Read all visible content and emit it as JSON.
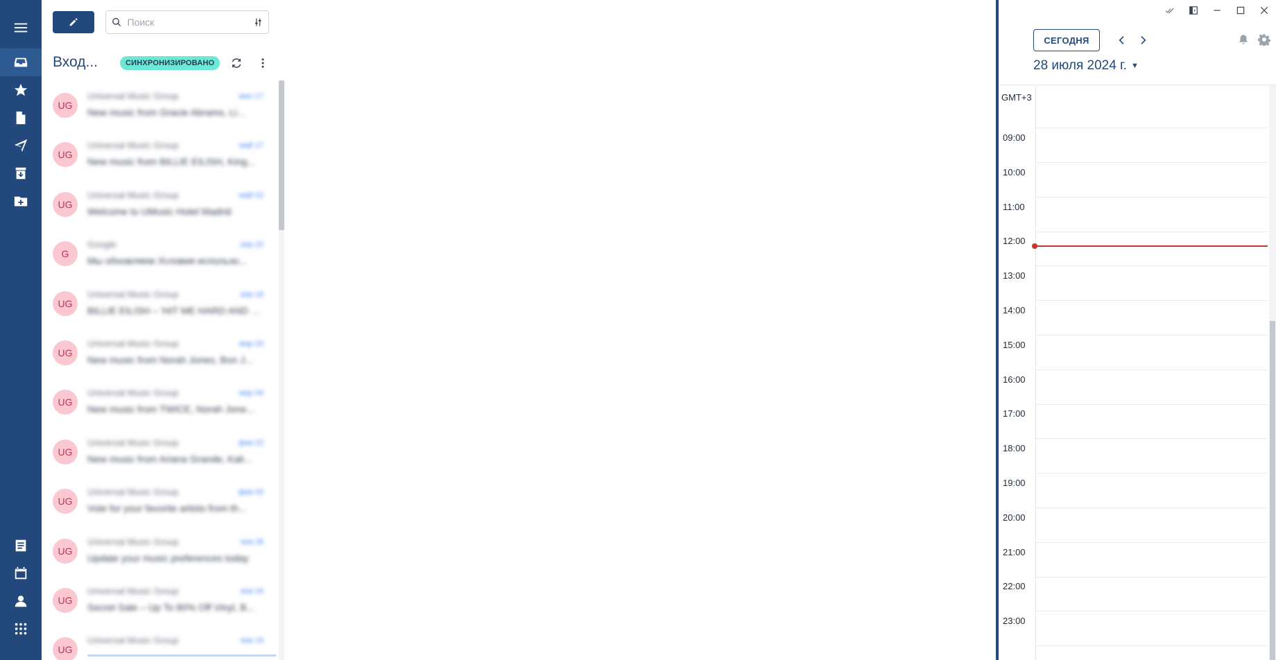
{
  "rail": {
    "items": [
      {
        "name": "menu",
        "icon": "hamburger-menu-icon"
      },
      {
        "name": "inbox",
        "icon": "inbox-icon"
      },
      {
        "name": "starred",
        "icon": "star-icon"
      },
      {
        "name": "drafts",
        "icon": "document-icon"
      },
      {
        "name": "sent",
        "icon": "paper-plane-icon"
      },
      {
        "name": "archive",
        "icon": "archive-icon"
      },
      {
        "name": "new-folder",
        "icon": "folder-add-icon"
      },
      {
        "name": "notes",
        "icon": "notes-icon"
      },
      {
        "name": "calendar",
        "icon": "calendar-icon"
      },
      {
        "name": "contacts",
        "icon": "contact-icon"
      },
      {
        "name": "apps",
        "icon": "apps-grid-icon"
      }
    ]
  },
  "search": {
    "placeholder": "Поиск"
  },
  "folder": {
    "title": "Вход...",
    "sync_status": "СИНХРОНИЗИРОВАНО"
  },
  "messages": [
    {
      "avatar": "UG",
      "sender": "Universal Music Group",
      "date": "июн 17",
      "subject": "New music from Gracie Abrams, Li..."
    },
    {
      "avatar": "UG",
      "sender": "Universal Music Group",
      "date": "май 17",
      "subject": "New music from BILLIE EILISH, King..."
    },
    {
      "avatar": "UG",
      "sender": "Universal Music Group",
      "date": "май 02",
      "subject": "Welcome to UMusic Hotel Madrid"
    },
    {
      "avatar": "G",
      "sender": "Google",
      "date": "апр 22",
      "subject": "Мы обновляем Условия использо..."
    },
    {
      "avatar": "UG",
      "sender": "Universal Music Group",
      "date": "апр 18",
      "subject": "BILLIE EILISH – 'HIT ME HARD AND S..."
    },
    {
      "avatar": "UG",
      "sender": "Universal Music Group",
      "date": "мар 20",
      "subject": "New music from Norah Jones, Bon J..."
    },
    {
      "avatar": "UG",
      "sender": "Universal Music Group",
      "date": "мар 04",
      "subject": "New music from TWICE, Norah Jone..."
    },
    {
      "avatar": "UG",
      "sender": "Universal Music Group",
      "date": "фев 22",
      "subject": "New music from Ariana Grande, Kali..."
    },
    {
      "avatar": "UG",
      "sender": "Universal Music Group",
      "date": "фев 03",
      "subject": "Vote for your favorite artists from th..."
    },
    {
      "avatar": "UG",
      "sender": "Universal Music Group",
      "date": "янв 28",
      "subject": "Update your music preferences today"
    },
    {
      "avatar": "UG",
      "sender": "Universal Music Group",
      "date": "янв 24",
      "subject": "Secret Sale – Up To 80% Off Vinyl, B..."
    },
    {
      "avatar": "UG",
      "sender": "Universal Music Group",
      "date": "янв 19",
      "subject": ""
    }
  ],
  "calendar": {
    "today_label": "СЕГОДНЯ",
    "date_label": "28 июля 2024 г.",
    "timezone": "GMT+3",
    "hours": [
      "09:00",
      "10:00",
      "11:00",
      "12:00",
      "13:00",
      "14:00",
      "15:00",
      "16:00",
      "17:00",
      "18:00",
      "19:00",
      "20:00",
      "21:00",
      "22:00",
      "23:00"
    ],
    "now_color": "#c0392b"
  },
  "colors": {
    "brand": "#23497c",
    "avatar_bg": "#fbc7d0",
    "avatar_fg": "#c2334f",
    "sync_badge": "#6ee7d8",
    "date": "#3b82f6"
  }
}
